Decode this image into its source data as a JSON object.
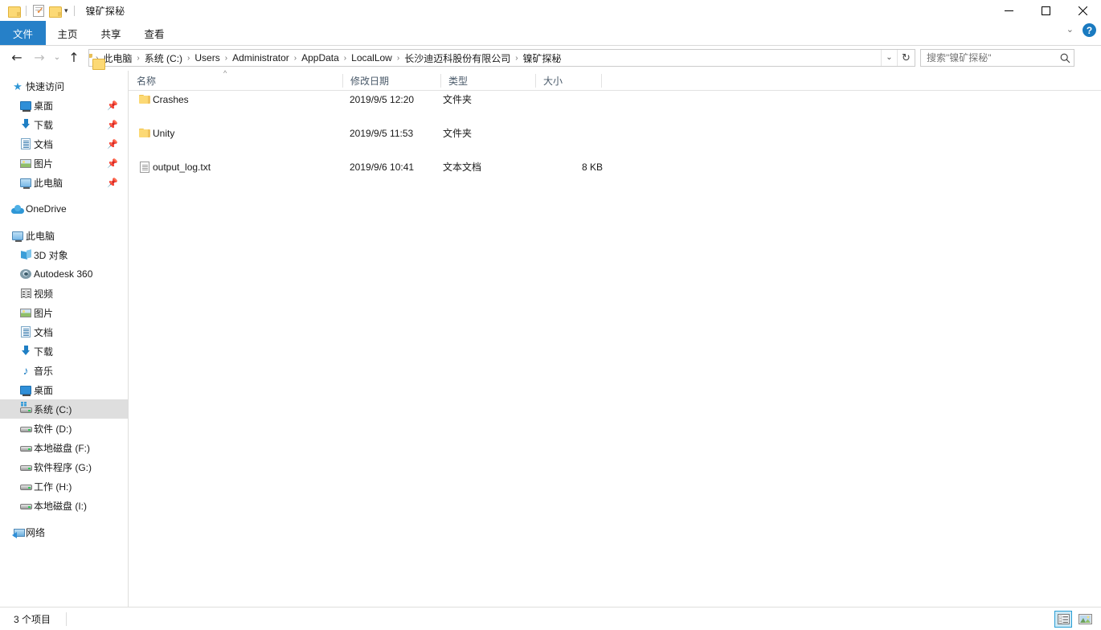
{
  "window": {
    "title": "镍矿探秘",
    "quick_access": [
      {
        "name": "folder-icon",
        "label": "文件夹"
      },
      {
        "name": "properties-icon",
        "label": "属性"
      },
      {
        "name": "new-folder-icon",
        "label": "新建文件夹"
      }
    ],
    "controls": {
      "minimize": "最小化",
      "maximize": "最大化",
      "close": "关闭"
    }
  },
  "ribbon": {
    "tabs": [
      {
        "label": "文件",
        "active": true
      },
      {
        "label": "主页",
        "active": false
      },
      {
        "label": "共享",
        "active": false
      },
      {
        "label": "查看",
        "active": false
      }
    ],
    "expand_label": "展开功能区",
    "help_label": "?"
  },
  "navigation": {
    "back_label": "后退",
    "forward_label": "前进",
    "recent_label": "最近浏览的位置",
    "up_label": "上移一级",
    "dropdown_label": "以前的位置",
    "refresh_label": "刷新",
    "breadcrumbs": [
      "此电脑",
      "系统 (C:)",
      "Users",
      "Administrator",
      "AppData",
      "LocalLow",
      "长沙迪迈科股份有限公司",
      "镍矿探秘"
    ]
  },
  "search": {
    "placeholder": "搜索\"镍矿探秘\"",
    "value": "",
    "icon": "search-icon"
  },
  "sidebar": {
    "groups": [
      {
        "header": {
          "label": "快速访问",
          "icon": "star-pin-icon"
        },
        "items": [
          {
            "label": "桌面",
            "icon": "desktop-icon",
            "pinned": true
          },
          {
            "label": "下载",
            "icon": "download-icon",
            "pinned": true
          },
          {
            "label": "文档",
            "icon": "documents-icon",
            "pinned": true
          },
          {
            "label": "图片",
            "icon": "pictures-icon",
            "pinned": true
          },
          {
            "label": "此电脑",
            "icon": "this-pc-icon",
            "pinned": true
          }
        ]
      },
      {
        "header": {
          "label": "OneDrive",
          "icon": "onedrive-cloud-icon"
        },
        "items": []
      },
      {
        "header": {
          "label": "此电脑",
          "icon": "this-pc-icon"
        },
        "items": [
          {
            "label": "3D 对象",
            "icon": "3d-objects-icon",
            "selected": false
          },
          {
            "label": "Autodesk 360",
            "icon": "autodesk-icon",
            "selected": false
          },
          {
            "label": "视频",
            "icon": "videos-icon",
            "selected": false
          },
          {
            "label": "图片",
            "icon": "pictures-icon",
            "selected": false
          },
          {
            "label": "文档",
            "icon": "documents-icon",
            "selected": false
          },
          {
            "label": "下载",
            "icon": "download-icon",
            "selected": false
          },
          {
            "label": "音乐",
            "icon": "music-icon",
            "selected": false
          },
          {
            "label": "桌面",
            "icon": "desktop-icon",
            "selected": false
          },
          {
            "label": "系统 (C:)",
            "icon": "system-drive-icon",
            "selected": true
          },
          {
            "label": "软件 (D:)",
            "icon": "drive-icon",
            "selected": false
          },
          {
            "label": "本地磁盘 (F:)",
            "icon": "drive-icon",
            "selected": false
          },
          {
            "label": "软件程序 (G:)",
            "icon": "drive-icon",
            "selected": false
          },
          {
            "label": "工作 (H:)",
            "icon": "drive-icon",
            "selected": false
          },
          {
            "label": "本地磁盘 (I:)",
            "icon": "drive-icon",
            "selected": false
          }
        ]
      },
      {
        "header": {
          "label": "网络",
          "icon": "network-icon"
        },
        "items": []
      }
    ]
  },
  "filelist": {
    "columns": [
      {
        "label": "名称",
        "sorted": "asc"
      },
      {
        "label": "修改日期",
        "sorted": ""
      },
      {
        "label": "类型",
        "sorted": ""
      },
      {
        "label": "大小",
        "sorted": ""
      }
    ],
    "rows": [
      {
        "name": "Crashes",
        "date": "2019/9/5 12:20",
        "type": "文件夹",
        "size": "",
        "icon": "folder-icon"
      },
      {
        "name": "Unity",
        "date": "2019/9/5 11:53",
        "type": "文件夹",
        "size": "",
        "icon": "folder-icon"
      },
      {
        "name": "output_log.txt",
        "date": "2019/9/6 10:41",
        "type": "文本文档",
        "size": "8 KB",
        "icon": "text-file-icon"
      }
    ]
  },
  "statusbar": {
    "item_count": "3 个项目",
    "views": [
      {
        "name": "details-view",
        "label": "详细信息",
        "active": true
      },
      {
        "name": "large-icons-view",
        "label": "大图标",
        "active": false
      }
    ]
  },
  "colors": {
    "accent": "#2680c8",
    "selection": "#dedede",
    "folder": "#fcd975",
    "header_text": "#4a5a6a",
    "view_active_bg": "#cce8f4",
    "view_active_border": "#2a9fd6"
  }
}
